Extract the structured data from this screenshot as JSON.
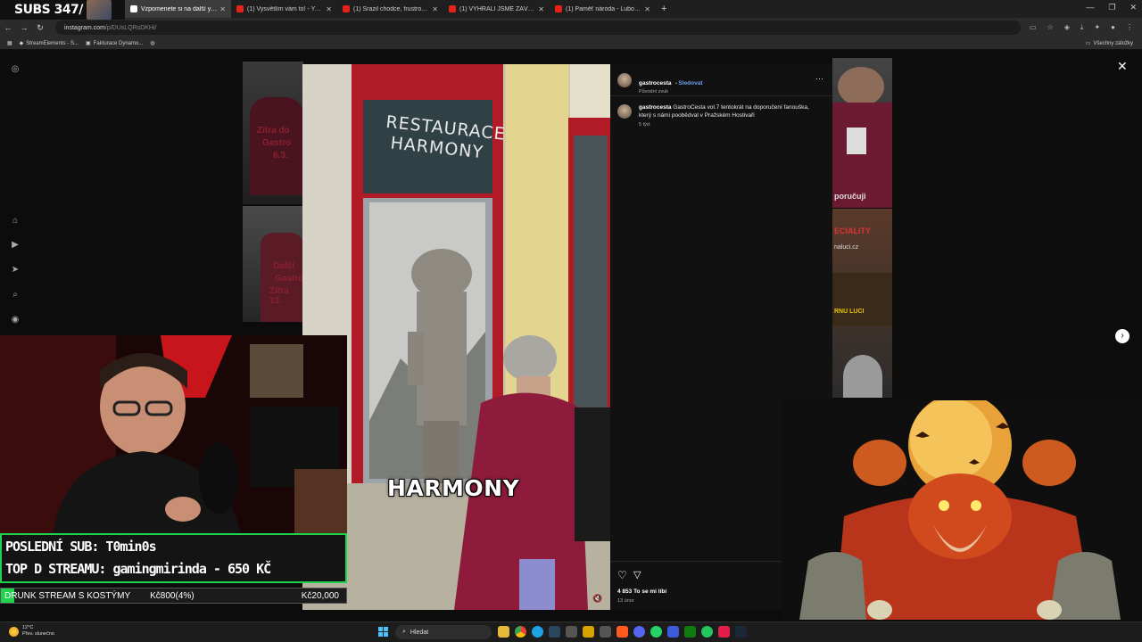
{
  "overlay": {
    "subs_counter": "SUBS 347/"
  },
  "browser": {
    "tabs": [
      {
        "label": "Vzpomenete si na další youtub",
        "active": false
      },
      {
        "label": "(1) Vysvětlím vám to! - YouTub",
        "active": false
      },
      {
        "label": "(1) Srazil chodce, frustrovaný ři",
        "active": false
      },
      {
        "label": "(1) VYHRÁLI JSME ZÁVODY NA",
        "active": false
      },
      {
        "label": "(1) Paměť národa - Luboš Bailo",
        "active": false
      }
    ],
    "url_host": "instagram.com",
    "url_path": "/p/DUsLQRsDKHi/",
    "bookmarks": [
      "StreamElements - S...",
      "Fakturace Dynamo..."
    ],
    "bookmarks_right": "Všechny záložky"
  },
  "post": {
    "username": "gastrocesta",
    "follow_label": "Sledovat",
    "audio_label": "Původní zvuk",
    "caption": "GastroCesta vol.7 tentokrát na doporučení fanouška, který s námi poobědval v Pražském Hostivaři",
    "caption_time": "5 týd.",
    "likes": "4 853 To se mi líbí",
    "date": "13 únor",
    "sign_line1": "RESTAURACE",
    "sign_line2": "HARMONY",
    "video_caption": "HARMONY",
    "more_icon": "ellipsis-icon"
  },
  "background_posts": {
    "left_texts": [
      "Zítra do",
      "Gastro",
      "6.3.",
      "Další",
      "Gastro",
      "Zítra 13."
    ],
    "right_texts": [
      "poručuji",
      "ECIALITY",
      "naluci.cz",
      "RNU LUCI"
    ]
  },
  "stream": {
    "last_sub": "POSLEDNÍ SUB: T0min0s",
    "top_d": "TOP D STREAMU: gamingmirinda - 650 KČ",
    "goal_name": "DRUNK STREAM S KOSTÝMY",
    "goal_current": "Kč800(4%)",
    "goal_target": "Kč20,000",
    "goal_progress": 0.04,
    "accent": "#1fd44c"
  },
  "taskbar": {
    "weather_temp": "12°C",
    "weather_desc": "Přev. slunečno",
    "search_placeholder": "Hledat"
  }
}
